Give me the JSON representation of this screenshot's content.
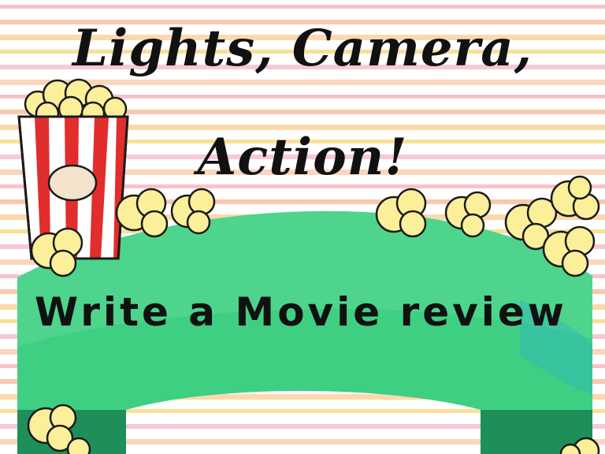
{
  "title": {
    "line1": "Lights, Camera,",
    "line2": "Action!"
  },
  "subtitle": "Write a Movie review",
  "colors": {
    "stripe_colors": [
      "#f7a6b4",
      "#f6b28a",
      "#f9c98a",
      "#f7d36b",
      "#f3b2c0",
      "#f9c4a0"
    ],
    "banner_green": "#3fcf83",
    "banner_dark": "#1f8f5a",
    "popcorn": "#fbef9a",
    "popcorn_outline": "#1b1b1b",
    "box_red": "#e22d2d"
  },
  "icons": [
    "popcorn-box-icon",
    "popcorn-kernel-icon"
  ]
}
